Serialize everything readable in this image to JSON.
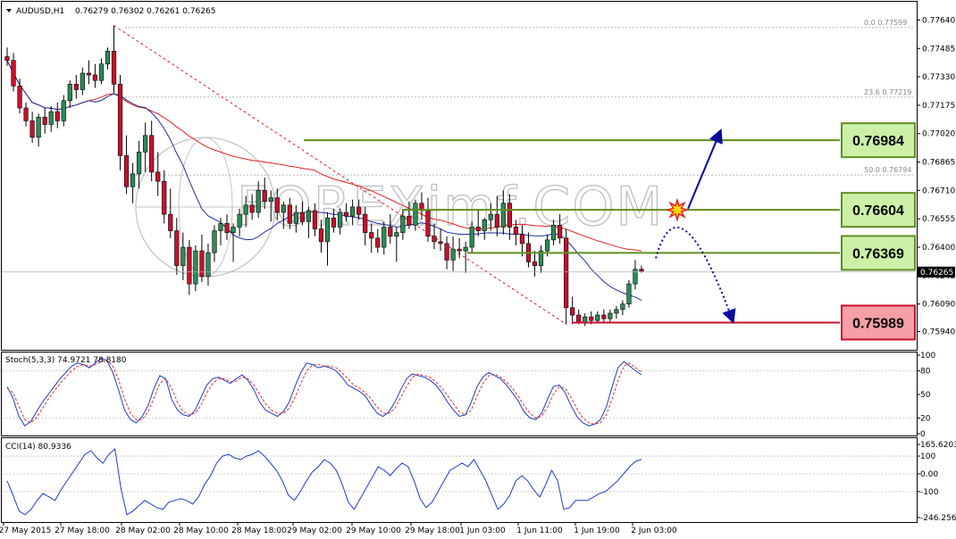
{
  "chart_data": [
    {
      "type": "candlestick",
      "title": "AUDUSD,H1",
      "ohlc_header": "0.76279 0.76302 0.76261 0.76265",
      "ylim": [
        0.7585,
        0.7772
      ],
      "y_ticks": [
        "0.77640",
        "0.77485",
        "0.77330",
        "0.77175",
        "0.77020",
        "0.76865",
        "0.76710",
        "0.76555",
        "0.76400",
        "0.76245",
        "0.76090",
        "0.75940"
      ],
      "current_price": "0.76265",
      "x_ticks": [
        "27 May 2015",
        "27 May 18:00",
        "28 May 02:00",
        "28 May 10:00",
        "28 May 18:00",
        "29 May 02:00",
        "29 May 10:00",
        "29 May 18:00",
        "1 Jun 03:00",
        "1 Jun 11:00",
        "1 Jun 19:00",
        "2 Jun 03:00"
      ],
      "candles": [
        [
          0.7744,
          0.7749,
          0.7739,
          0.7742
        ],
        [
          0.7742,
          0.7746,
          0.7725,
          0.7728
        ],
        [
          0.7728,
          0.7732,
          0.7713,
          0.7716
        ],
        [
          0.7716,
          0.7719,
          0.7706,
          0.7709
        ],
        [
          0.7709,
          0.7714,
          0.7697,
          0.77
        ],
        [
          0.77,
          0.7713,
          0.7695,
          0.7711
        ],
        [
          0.7711,
          0.7716,
          0.7702,
          0.7707
        ],
        [
          0.7707,
          0.7717,
          0.7703,
          0.7714
        ],
        [
          0.7714,
          0.7719,
          0.7705,
          0.7709
        ],
        [
          0.7709,
          0.7723,
          0.7706,
          0.772
        ],
        [
          0.772,
          0.7731,
          0.7716,
          0.7729
        ],
        [
          0.7729,
          0.7734,
          0.7721,
          0.7726
        ],
        [
          0.7726,
          0.7738,
          0.7723,
          0.7735
        ],
        [
          0.7735,
          0.7742,
          0.7729,
          0.7734
        ],
        [
          0.7734,
          0.774,
          0.7727,
          0.7731
        ],
        [
          0.7731,
          0.7743,
          0.7729,
          0.774
        ],
        [
          0.774,
          0.7749,
          0.7737,
          0.7747
        ],
        [
          0.7747,
          0.7761,
          0.7724,
          0.7729
        ],
        [
          0.7729,
          0.7734,
          0.7682,
          0.769
        ],
        [
          0.769,
          0.7701,
          0.7669,
          0.7673
        ],
        [
          0.7673,
          0.7686,
          0.7664,
          0.768
        ],
        [
          0.768,
          0.7698,
          0.7672,
          0.7692
        ],
        [
          0.7692,
          0.7708,
          0.7681,
          0.7701
        ],
        [
          0.7701,
          0.7709,
          0.7676,
          0.7681
        ],
        [
          0.7681,
          0.7692,
          0.7668,
          0.7676
        ],
        [
          0.7676,
          0.7682,
          0.7653,
          0.7658
        ],
        [
          0.7658,
          0.7672,
          0.7645,
          0.7649
        ],
        [
          0.7649,
          0.7656,
          0.7625,
          0.763
        ],
        [
          0.763,
          0.7648,
          0.7622,
          0.764
        ],
        [
          0.764,
          0.7644,
          0.7614,
          0.762
        ],
        [
          0.762,
          0.7641,
          0.7616,
          0.7638
        ],
        [
          0.7638,
          0.7647,
          0.7621,
          0.7624
        ],
        [
          0.7624,
          0.7642,
          0.7619,
          0.7637
        ],
        [
          0.7637,
          0.7652,
          0.7632,
          0.7649
        ],
        [
          0.7649,
          0.7656,
          0.7641,
          0.7653
        ],
        [
          0.7653,
          0.7658,
          0.7644,
          0.7648
        ],
        [
          0.7648,
          0.7653,
          0.7632,
          0.7651
        ],
        [
          0.7651,
          0.7661,
          0.7646,
          0.7658
        ],
        [
          0.7658,
          0.7668,
          0.7651,
          0.7663
        ],
        [
          0.7663,
          0.7669,
          0.7655,
          0.7659
        ],
        [
          0.7659,
          0.7676,
          0.7656,
          0.7671
        ],
        [
          0.7671,
          0.7678,
          0.7661,
          0.7665
        ],
        [
          0.7665,
          0.7671,
          0.7654,
          0.7667
        ],
        [
          0.7667,
          0.7672,
          0.7655,
          0.7659
        ],
        [
          0.7659,
          0.7665,
          0.765,
          0.7663
        ],
        [
          0.7663,
          0.7667,
          0.765,
          0.7653
        ],
        [
          0.7653,
          0.7663,
          0.7648,
          0.7659
        ],
        [
          0.7659,
          0.7665,
          0.7652,
          0.7654
        ],
        [
          0.7654,
          0.7662,
          0.7645,
          0.766
        ],
        [
          0.766,
          0.7664,
          0.7646,
          0.765
        ],
        [
          0.765,
          0.7655,
          0.7637,
          0.7643
        ],
        [
          0.7643,
          0.7659,
          0.763,
          0.7656
        ],
        [
          0.7656,
          0.7661,
          0.7648,
          0.7651
        ],
        [
          0.7651,
          0.7661,
          0.7647,
          0.7659
        ],
        [
          0.7659,
          0.7664,
          0.7654,
          0.7657
        ],
        [
          0.7657,
          0.7666,
          0.7652,
          0.7662
        ],
        [
          0.7662,
          0.7666,
          0.7655,
          0.7658
        ],
        [
          0.7658,
          0.7662,
          0.7641,
          0.7648
        ],
        [
          0.7648,
          0.7653,
          0.7637,
          0.7645
        ],
        [
          0.7645,
          0.765,
          0.7637,
          0.764
        ],
        [
          0.764,
          0.7654,
          0.7636,
          0.7651
        ],
        [
          0.7651,
          0.7658,
          0.7642,
          0.7646
        ],
        [
          0.7646,
          0.7651,
          0.7632,
          0.7648
        ],
        [
          0.7648,
          0.766,
          0.7644,
          0.7657
        ],
        [
          0.7657,
          0.7665,
          0.765,
          0.7652
        ],
        [
          0.7652,
          0.7666,
          0.7649,
          0.7664
        ],
        [
          0.7664,
          0.767,
          0.7655,
          0.766
        ],
        [
          0.766,
          0.7667,
          0.7643,
          0.7646
        ],
        [
          0.7646,
          0.7653,
          0.7639,
          0.7643
        ],
        [
          0.7643,
          0.765,
          0.7638,
          0.7642
        ],
        [
          0.7642,
          0.7646,
          0.7628,
          0.7633
        ],
        [
          0.7633,
          0.7646,
          0.7627,
          0.7639
        ],
        [
          0.7639,
          0.7645,
          0.7634,
          0.7638
        ],
        [
          0.7638,
          0.7643,
          0.7626,
          0.764
        ],
        [
          0.764,
          0.7654,
          0.7637,
          0.7651
        ],
        [
          0.7651,
          0.7661,
          0.7646,
          0.7649
        ],
        [
          0.7649,
          0.7656,
          0.7644,
          0.7655
        ],
        [
          0.7655,
          0.7664,
          0.7649,
          0.7658
        ],
        [
          0.7658,
          0.7668,
          0.7646,
          0.7651
        ],
        [
          0.7651,
          0.7671,
          0.7647,
          0.7664
        ],
        [
          0.7664,
          0.7669,
          0.7644,
          0.7651
        ],
        [
          0.7651,
          0.7655,
          0.7641,
          0.7647
        ],
        [
          0.7647,
          0.7652,
          0.7635,
          0.7642
        ],
        [
          0.7642,
          0.7648,
          0.7629,
          0.7632
        ],
        [
          0.7632,
          0.7638,
          0.7624,
          0.763
        ],
        [
          0.763,
          0.7641,
          0.7626,
          0.7638
        ],
        [
          0.7638,
          0.7647,
          0.7635,
          0.7644
        ],
        [
          0.7644,
          0.7655,
          0.7641,
          0.7652
        ],
        [
          0.7652,
          0.7658,
          0.7642,
          0.7645
        ],
        [
          0.7645,
          0.765,
          0.7598,
          0.7607
        ],
        [
          0.7607,
          0.7613,
          0.7598,
          0.7603
        ],
        [
          0.7603,
          0.7606,
          0.7598,
          0.7599
        ],
        [
          0.7599,
          0.7604,
          0.7597,
          0.7602
        ],
        [
          0.7602,
          0.7605,
          0.7598,
          0.76
        ],
        [
          0.76,
          0.7605,
          0.7599,
          0.7603
        ],
        [
          0.7603,
          0.7606,
          0.7599,
          0.7601
        ],
        [
          0.7601,
          0.7606,
          0.7599,
          0.7604
        ],
        [
          0.7604,
          0.7608,
          0.7601,
          0.7606
        ],
        [
          0.7606,
          0.7611,
          0.7603,
          0.7609
        ],
        [
          0.7609,
          0.7622,
          0.7607,
          0.762
        ],
        [
          0.762,
          0.7633,
          0.7617,
          0.7628
        ],
        [
          0.7628,
          0.763,
          0.7626,
          0.7627
        ]
      ],
      "levels": [
        {
          "value": "0.76984",
          "price": 0.76984,
          "color": "#5f8f1f",
          "box": "#ccf0a8",
          "kind": "resistance"
        },
        {
          "value": "0.76604",
          "price": 0.76604,
          "color": "#5f8f1f",
          "box": "#ccf0a8",
          "kind": "resistance"
        },
        {
          "value": "0.76369",
          "price": 0.76369,
          "color": "#5f8f1f",
          "box": "#ccf0a8",
          "kind": "resistance"
        },
        {
          "value": "0.75989",
          "price": 0.75989,
          "color": "#c8102e",
          "box": "#f4a0a6",
          "kind": "support"
        }
      ],
      "fibonacci": [
        {
          "label": "0.0",
          "value": "0.77599",
          "price": 0.77599
        },
        {
          "label": "23.6",
          "value": "0.77219",
          "price": 0.77219
        },
        {
          "label": "50.0",
          "value": "0.76794",
          "price": 0.76794
        }
      ],
      "watermark": "FOREXimf.COM"
    },
    {
      "type": "line",
      "title": "Stoch(5,3,3) 74.9721 78.8180",
      "ylim": [
        0,
        100
      ],
      "y_ticks": [
        "100",
        "80",
        "50",
        "20",
        "0"
      ],
      "series": [
        {
          "color": "#1f3ccc",
          "values": [
            60,
            45,
            22,
            10,
            15,
            28,
            40,
            50,
            60,
            70,
            78,
            86,
            90,
            88,
            84,
            90,
            96,
            93,
            78,
            55,
            30,
            18,
            14,
            22,
            36,
            58,
            74,
            70,
            44,
            30,
            24,
            22,
            30,
            46,
            62,
            70,
            72,
            68,
            64,
            70,
            75,
            68,
            56,
            40,
            30,
            26,
            22,
            28,
            40,
            60,
            78,
            90,
            88,
            84,
            86,
            84,
            80,
            72,
            62,
            58,
            54,
            48,
            36,
            26,
            22,
            28,
            40,
            56,
            70,
            76,
            74,
            72,
            68,
            62,
            52,
            40,
            30,
            22,
            24,
            40,
            60,
            72,
            78,
            74,
            70,
            62,
            52,
            42,
            28,
            20,
            18,
            26,
            44,
            60,
            62,
            52,
            36,
            22,
            14,
            10,
            12,
            18,
            34,
            60,
            84,
            92,
            86,
            80,
            75
          ]
        },
        {
          "color": "#e03030",
          "dash": true,
          "values": [
            58,
            52,
            35,
            18,
            14,
            20,
            32,
            44,
            54,
            64,
            72,
            80,
            86,
            88,
            86,
            88,
            92,
            94,
            86,
            68,
            44,
            26,
            18,
            18,
            28,
            46,
            64,
            70,
            58,
            40,
            28,
            24,
            26,
            36,
            52,
            64,
            70,
            70,
            66,
            67,
            72,
            70,
            62,
            50,
            38,
            30,
            26,
            26,
            32,
            46,
            64,
            80,
            88,
            88,
            86,
            86,
            84,
            78,
            70,
            62,
            58,
            52,
            44,
            34,
            26,
            26,
            32,
            46,
            60,
            72,
            76,
            74,
            72,
            66,
            58,
            48,
            38,
            28,
            24,
            30,
            48,
            64,
            74,
            76,
            72,
            66,
            58,
            48,
            36,
            26,
            20,
            22,
            34,
            50,
            60,
            58,
            46,
            32,
            20,
            14,
            12,
            14,
            24,
            44,
            68,
            86,
            90,
            84,
            78.8
          ]
        }
      ]
    },
    {
      "type": "line",
      "title": "CCI(14) 80.9336",
      "ylim": [
        -246.2561,
        165.6203
      ],
      "y_ticks": [
        "165.6203",
        "100",
        "0.00",
        "-100",
        "-246.2561"
      ],
      "series": [
        {
          "color": "#1f3ccc",
          "values": [
            -40,
            -120,
            -210,
            -230,
            -200,
            -150,
            -110,
            -130,
            -150,
            -90,
            -40,
            10,
            60,
            110,
            130,
            90,
            60,
            110,
            140,
            -80,
            -230,
            -210,
            -180,
            -150,
            -170,
            -190,
            -200,
            -160,
            -150,
            -140,
            -150,
            -170,
            -130,
            -60,
            -10,
            60,
            100,
            110,
            90,
            80,
            100,
            110,
            130,
            100,
            60,
            20,
            -40,
            -120,
            -150,
            -100,
            -40,
            10,
            40,
            80,
            60,
            20,
            -60,
            -160,
            -200,
            -140,
            -80,
            -20,
            40,
            20,
            -10,
            30,
            60,
            40,
            -40,
            -140,
            -190,
            -160,
            -100,
            -40,
            20,
            40,
            60,
            40,
            80,
            20,
            -40,
            -120,
            -200,
            -170,
            -120,
            -40,
            -10,
            -40,
            -90,
            -130,
            -60,
            20,
            -40,
            -200,
            -190,
            -150,
            -150,
            -150,
            -130,
            -110,
            -100,
            -70,
            -40,
            0,
            40,
            70,
            80.9
          ]
        }
      ]
    }
  ],
  "xaxis_labels_shared": true
}
